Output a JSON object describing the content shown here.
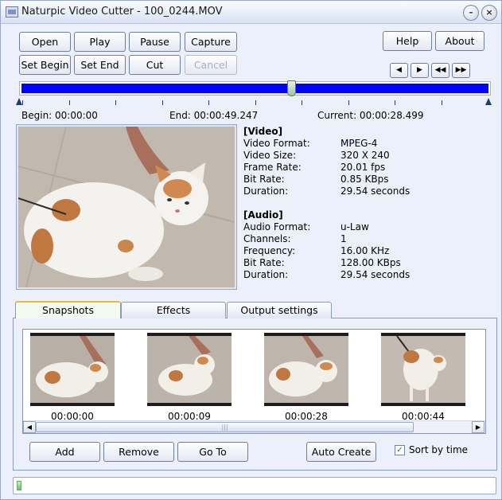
{
  "window": {
    "title": "Naturpic Video Cutter - 100_0244.MOV"
  },
  "titlebar_buttons": {
    "minimize": "–",
    "close": "×"
  },
  "toolbar": {
    "open": "Open",
    "play": "Play",
    "pause": "Pause",
    "capture": "Capture",
    "set_begin": "Set Begin",
    "set_end": "Set End",
    "cut": "Cut",
    "cancel": "Cancel",
    "help": "Help",
    "about": "About"
  },
  "nav_buttons": [
    {
      "name": "step-back",
      "glyph": "◀"
    },
    {
      "name": "step-forward",
      "glyph": "▶"
    },
    {
      "name": "rewind",
      "glyph": "◀◀"
    },
    {
      "name": "fast-forward",
      "glyph": "▶▶"
    }
  ],
  "timeline": {
    "begin_label": "Begin: 00:00:00",
    "end_label": "End: 00:00:49.247",
    "current_label": "Current: 00:00:28.499",
    "current_fraction": 0.578,
    "colors": {
      "track": "#0000ff"
    }
  },
  "info": {
    "video_header": "[Video]",
    "video": [
      {
        "key": "Video Format:",
        "value": "MPEG-4"
      },
      {
        "key": "Video Size:",
        "value": "320 X 240"
      },
      {
        "key": "Frame Rate:",
        "value": "20.01 fps"
      },
      {
        "key": "Bit Rate:",
        "value": "0.85 KBps"
      },
      {
        "key": "Duration:",
        "value": "29.54 seconds"
      }
    ],
    "audio_header": "[Audio]",
    "audio": [
      {
        "key": "Audio Format:",
        "value": "u-Law"
      },
      {
        "key": "Channels:",
        "value": "1"
      },
      {
        "key": "Frequency:",
        "value": "16.00 KHz"
      },
      {
        "key": "Bit Rate:",
        "value": "128.00 KBps"
      },
      {
        "key": "Duration:",
        "value": "29.54 seconds"
      }
    ]
  },
  "tabs": [
    "Snapshots",
    "Effects",
    "Output settings"
  ],
  "snapshots": [
    {
      "time": "00:00:00"
    },
    {
      "time": "00:00:09"
    },
    {
      "time": "00:00:28"
    },
    {
      "time": "00:00:44"
    }
  ],
  "scrollbar": {
    "left": "◀",
    "right": "▶",
    "grip": "|||"
  },
  "bottom": {
    "add": "Add",
    "remove": "Remove",
    "go_to": "Go To",
    "auto_create": "Auto Create",
    "sort_by_time": "Sort by time",
    "sort_checked": true
  },
  "status": {
    "progress_fraction": 0.01
  }
}
